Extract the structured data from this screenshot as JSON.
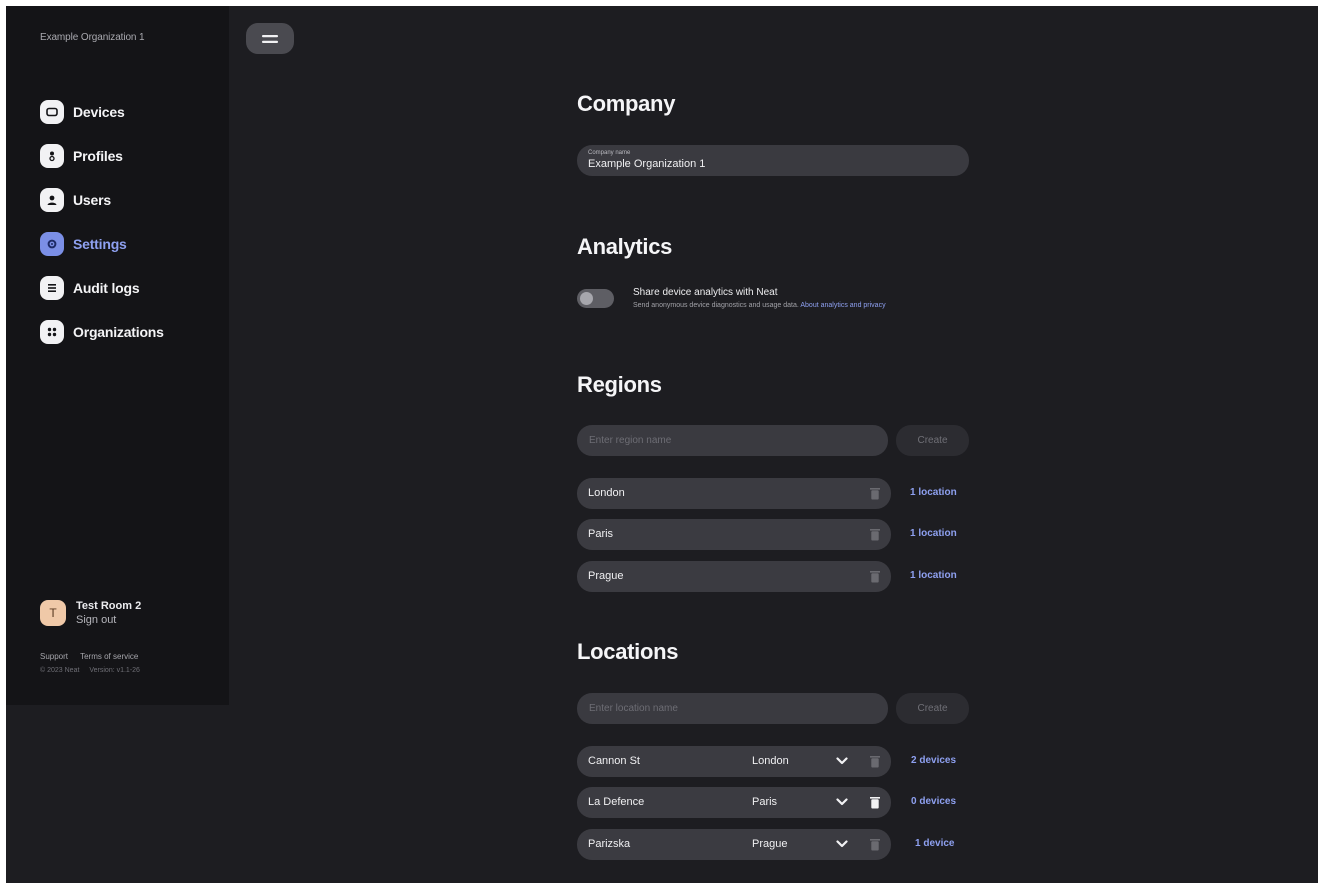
{
  "sidebar": {
    "org_name": "Example Organization 1",
    "nav": [
      {
        "label": "Devices",
        "icon": "devices-icon"
      },
      {
        "label": "Profiles",
        "icon": "profiles-icon"
      },
      {
        "label": "Users",
        "icon": "user-icon"
      },
      {
        "label": "Settings",
        "icon": "gear-icon",
        "active": true
      },
      {
        "label": "Audit logs",
        "icon": "list-icon"
      },
      {
        "label": "Organizations",
        "icon": "grid-icon"
      }
    ],
    "profile": {
      "initial": "T",
      "name": "Test Room 2",
      "sign_out": "Sign out"
    },
    "footer": {
      "support": "Support",
      "terms": "Terms of service",
      "copyright": "© 2023 Neat",
      "version": "Version: v1.1-26"
    }
  },
  "header": {
    "menu_icon": "hamburger-icon"
  },
  "company": {
    "title": "Company",
    "field_label": "Company name",
    "field_value": "Example Organization 1"
  },
  "analytics": {
    "title": "Analytics",
    "toggle_state": "off",
    "toggle_label": "Share device analytics with Neat",
    "description": "Send anonymous device diagnostics and usage data.",
    "link_text": "About analytics and privacy"
  },
  "regions": {
    "title": "Regions",
    "input_placeholder": "Enter region name",
    "create_label": "Create",
    "items": [
      {
        "name": "London",
        "count": "1 location"
      },
      {
        "name": "Paris",
        "count": "1 location"
      },
      {
        "name": "Prague",
        "count": "1 location"
      }
    ]
  },
  "locations": {
    "title": "Locations",
    "input_placeholder": "Enter location name",
    "create_label": "Create",
    "items": [
      {
        "name": "Cannon St",
        "region": "London",
        "count": "2 devices"
      },
      {
        "name": "La Defence",
        "region": "Paris",
        "count": "0 devices"
      },
      {
        "name": "Parizska",
        "region": "Prague",
        "count": "1 device"
      }
    ]
  },
  "colors": {
    "background": "#1d1d21",
    "sidebar": "#141417",
    "accent": "#8ea0f0",
    "field": "#3a3a40"
  }
}
